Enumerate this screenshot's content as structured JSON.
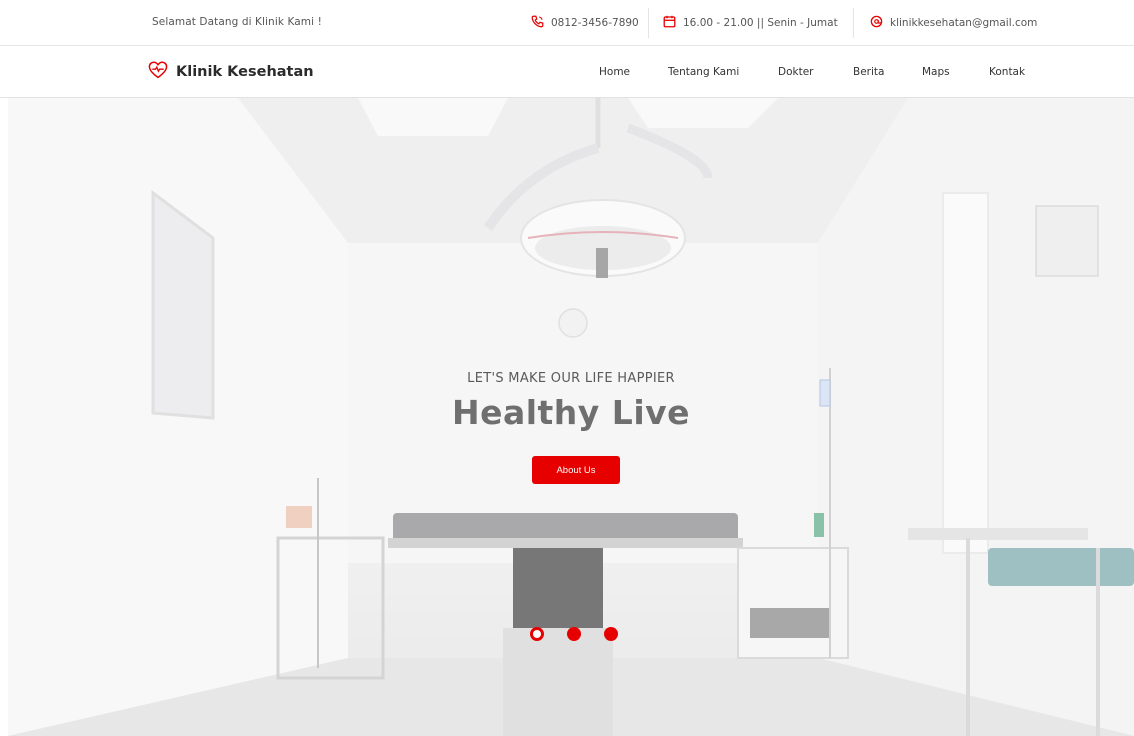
{
  "topbar": {
    "welcome": "Selamat Datang di Klinik Kami !",
    "phone": "0812-3456-7890",
    "hours": "16.00 - 21.00 || Senin - Jumat",
    "email": "klinikkesehatan@gmail.com",
    "icons": [
      "phone-icon",
      "calendar-icon",
      "email-icon"
    ]
  },
  "brand": {
    "name": "Klinik Kesehatan",
    "icon": "heart-pulse-icon"
  },
  "nav": {
    "items": [
      "Home",
      "Tentang Kami",
      "Dokter",
      "Berita",
      "Maps",
      "Kontak"
    ]
  },
  "hero": {
    "eyebrow": "LET'S MAKE OUR LIFE HAPPIER",
    "headline": "Healthy Live",
    "cta_label": "About Us",
    "slides": 3,
    "active_slide": 1
  },
  "colors": {
    "accent": "#e60000",
    "text": "#333333"
  }
}
